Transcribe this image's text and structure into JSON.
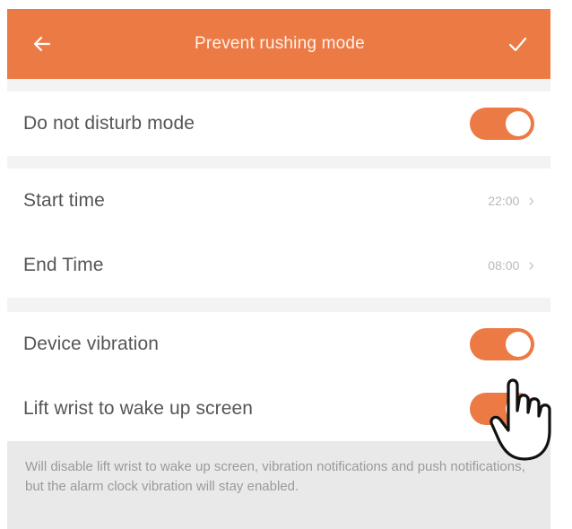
{
  "header": {
    "back_icon": "arrow-left-icon",
    "title": "Prevent rushing mode",
    "confirm_icon": "checkmark-icon",
    "background_color": "#ec7a45"
  },
  "rows": {
    "do_not_disturb": {
      "label": "Do not disturb mode",
      "toggle_on": true
    },
    "start_time": {
      "label": "Start time",
      "value": "22:00"
    },
    "end_time": {
      "label": "End Time",
      "value": "08:00"
    },
    "device_vibration": {
      "label": "Device vibration",
      "toggle_on": true
    },
    "lift_wrist": {
      "label": "Lift wrist to wake up screen",
      "toggle_on": true
    }
  },
  "footnote": "Will disable lift wrist to wake up screen, vibration notifications and push notifications, but the alarm clock vibration will stay enabled.",
  "accent_color": "#ec7a45",
  "chevron_icon": "chevron-right-icon",
  "cursor_icon": "hand-pointer-icon"
}
